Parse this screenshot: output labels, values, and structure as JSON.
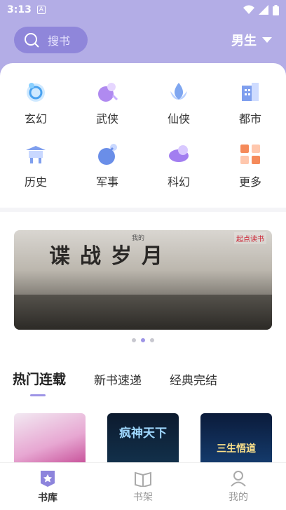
{
  "status_bar": {
    "time": "3:13",
    "notification_icon": "A"
  },
  "header": {
    "search_label": "搜书",
    "gender_label": "男生"
  },
  "categories": [
    {
      "label": "玄幻",
      "icon": "xuanhuan-icon"
    },
    {
      "label": "武侠",
      "icon": "wuxia-icon"
    },
    {
      "label": "仙侠",
      "icon": "xianxia-icon"
    },
    {
      "label": "都市",
      "icon": "dushi-icon"
    },
    {
      "label": "历史",
      "icon": "lishi-icon"
    },
    {
      "label": "军事",
      "icon": "junshi-icon"
    },
    {
      "label": "科幻",
      "icon": "kehuan-icon"
    },
    {
      "label": "更多",
      "icon": "more-grid-icon"
    }
  ],
  "banner": {
    "title": "谍战岁月",
    "subtitle": "我的",
    "logo": "起点读书"
  },
  "tabs": [
    {
      "label": "热门连载",
      "active": true
    },
    {
      "label": "新书速递",
      "active": false
    },
    {
      "label": "经典完结",
      "active": false
    }
  ],
  "books": [
    {
      "title": ""
    },
    {
      "title": "疯神天下"
    },
    {
      "title": "三生悟道"
    }
  ],
  "bottom_nav": [
    {
      "label": "书库",
      "active": true
    },
    {
      "label": "书架",
      "active": false
    },
    {
      "label": "我的",
      "active": false
    }
  ],
  "colors": {
    "accent": "#9e95e6",
    "header_bg": "#b3ade6",
    "search_bg": "#8f86da"
  }
}
